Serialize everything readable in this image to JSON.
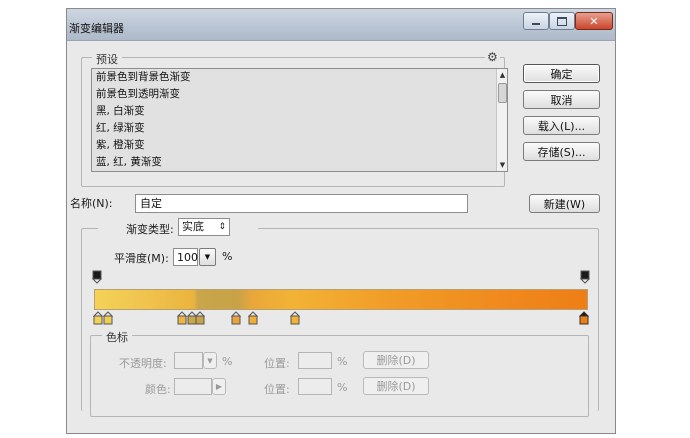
{
  "window": {
    "title": "渐变编辑器"
  },
  "presets": {
    "legend": "预设",
    "gear_icon": "gear-icon",
    "items": [
      "前景色到背景色渐变",
      "前景色到透明渐变",
      "黑, 白渐变",
      "红, 绿渐变",
      "紫, 橙渐变",
      "蓝, 红, 黄渐变"
    ]
  },
  "buttons": {
    "ok": "确定",
    "cancel": "取消",
    "load": "载入(L)...",
    "save": "存储(S)...",
    "new": "新建(W)"
  },
  "name": {
    "label": "名称(N):",
    "value": "自定"
  },
  "gradient": {
    "type_label": "渐变类型:",
    "type_value": "实底",
    "smoothness_label": "平滑度(M):",
    "smoothness_value": "100",
    "smoothness_unit": "%",
    "end_color": "#ee7e16",
    "start_color": "#f4d257"
  },
  "color_stops": {
    "legend": "色标",
    "opacity_label": "不透明度:",
    "opacity_unit": "%",
    "location_label_1": "位置:",
    "location_unit_1": "%",
    "delete_label_1": "删除(D)",
    "color_label": "颜色:",
    "location_label_2": "位置:",
    "location_unit_2": "%",
    "delete_label_2": "删除(D)"
  }
}
